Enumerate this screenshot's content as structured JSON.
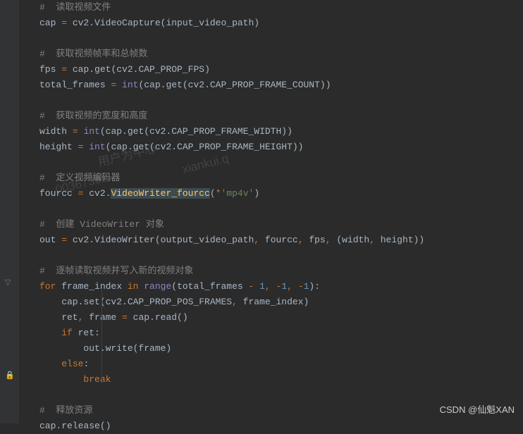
{
  "code": {
    "l1_comment": "#  读取视频文件",
    "l2": {
      "a": "cap ",
      "b": "=",
      "c": " cv2.VideoCapture(input_video_path)"
    },
    "l4_comment": "#  获取视频帧率和总帧数",
    "l5": {
      "a": "fps ",
      "b": "=",
      "c": " cap.get(cv2.CAP_PROP_FPS)"
    },
    "l6": {
      "a": "total_frames ",
      "b": "=",
      "c": " ",
      "d": "int",
      "e": "(cap.get(cv2.CAP_PROP_FRAME_COUNT))"
    },
    "l8_comment": "#  获取视频的宽度和高度",
    "l9": {
      "a": "width ",
      "b": "=",
      "c": " ",
      "d": "int",
      "e": "(cap.get(cv2.CAP_PROP_FRAME_WIDTH))"
    },
    "l10": {
      "a": "height ",
      "b": "=",
      "c": " ",
      "d": "int",
      "e": "(cap.get(cv2.CAP_PROP_FRAME_HEIGHT))"
    },
    "l12_comment": "#  定义视频编码器",
    "l13": {
      "a": "fourcc ",
      "b": "=",
      "c": " cv2.",
      "d": "VideoWriter_fourcc",
      "e": "(",
      "f": "*",
      "g": "'mp4v'",
      "h": ")"
    },
    "l15_comment": "#  创建 VideoWriter 对象",
    "l16": {
      "a": "out ",
      "b": "=",
      "c": " cv2.VideoWriter(output_video_path",
      "d": ", ",
      "e": "fourcc",
      "f": ", ",
      "g": "fps",
      "h": ", ",
      "i": "(width",
      "j": ", ",
      "k": "height))"
    },
    "l18_comment": "#  逐帧读取视频并写入新的视频对象",
    "l19": {
      "a": "for ",
      "b": "frame_index ",
      "c": "in ",
      "d": "range",
      "e": "(total_frames ",
      "f": "- ",
      "g": "1",
      "h": ", ",
      "i": "-",
      "j": "1",
      "k": ", ",
      "l": "-",
      "m": "1",
      "n": "):"
    },
    "l20": {
      "a": "    cap.set(cv2.CAP_PROP_POS_FRAMES",
      "b": ", ",
      "c": "frame_index)"
    },
    "l21": {
      "a": "    ret",
      "b": ", ",
      "c": "frame ",
      "d": "=",
      "e": " cap.read()"
    },
    "l22": {
      "a": "    ",
      "b": "if ",
      "c": "ret:"
    },
    "l23": {
      "a": "        out.write(frame)"
    },
    "l24": {
      "a": "    ",
      "b": "else",
      "c": ":"
    },
    "l25": {
      "a": "        ",
      "b": "break"
    },
    "l27_comment": "#  释放资源",
    "l28": {
      "a": "cap.release()"
    }
  },
  "watermark": {
    "w1": "用户为中心",
    "w2": "00367392",
    "w3": "xiankui.q"
  },
  "attribution": "CSDN @仙魁XAN"
}
